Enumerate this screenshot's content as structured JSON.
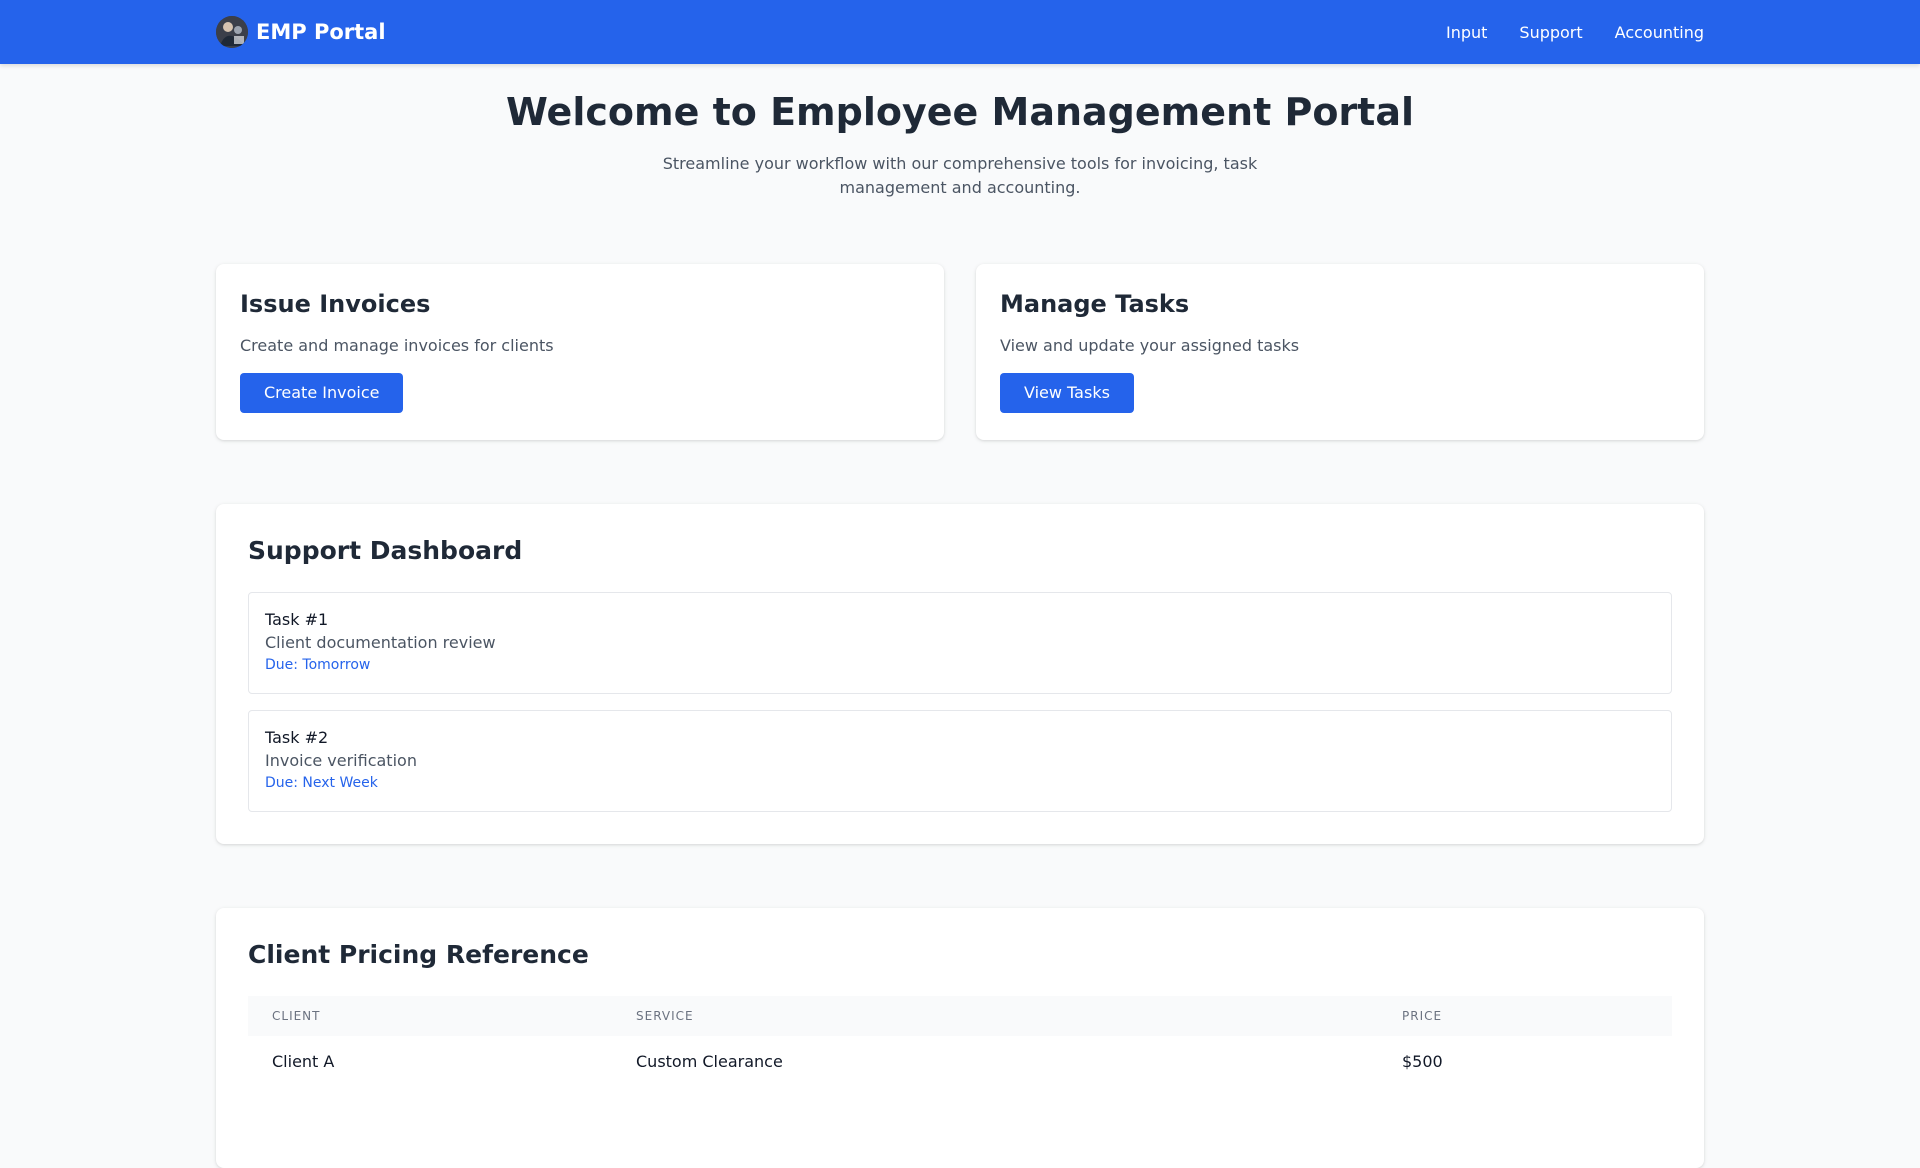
{
  "navbar": {
    "brand": "EMP Portal",
    "links": [
      "Input",
      "Support",
      "Accounting"
    ]
  },
  "hero": {
    "title": "Welcome to Employee Management Portal",
    "subtitle": "Streamline your workflow with our comprehensive tools for invoicing, task management and accounting."
  },
  "features": [
    {
      "title": "Issue Invoices",
      "description": "Create and manage invoices for clients",
      "button": "Create Invoice"
    },
    {
      "title": "Manage Tasks",
      "description": "View and update your assigned tasks",
      "button": "View Tasks"
    }
  ],
  "support": {
    "title": "Support Dashboard",
    "tasks": [
      {
        "title": "Task #1",
        "description": "Client documentation review",
        "due": "Due: Tomorrow"
      },
      {
        "title": "Task #2",
        "description": "Invoice verification",
        "due": "Due: Next Week"
      }
    ]
  },
  "pricing": {
    "title": "Client Pricing Reference",
    "headers": [
      "CLIENT",
      "SERVICE",
      "PRICE"
    ],
    "rows": [
      {
        "client": "Client A",
        "service": "Custom Clearance",
        "price": "$500"
      }
    ]
  },
  "colors": {
    "primary": "#2563eb",
    "background": "#f9fafb",
    "text": "#1f2937",
    "muted": "#4b5563"
  }
}
